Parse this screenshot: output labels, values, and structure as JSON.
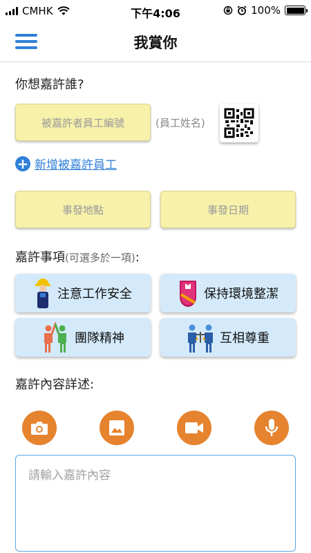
{
  "status_bar": {
    "carrier": "CMHK",
    "time": "下午4:06",
    "battery": "100%",
    "battery_level": 1.0
  },
  "header": {
    "title": "我賞你"
  },
  "recipient": {
    "label": "你想嘉許誰?",
    "employee_id_placeholder": "被嘉許者員工編號",
    "employee_name": "(員工姓名)",
    "add_link": "新增被嘉許員工"
  },
  "event": {
    "location_placeholder": "事發地點",
    "date_placeholder": "事發日期"
  },
  "praise": {
    "label": "嘉許事項",
    "hint": "(可選多於一項)",
    "colon": ":",
    "items": [
      {
        "label": "注意工作安全",
        "icon": "safety-worker-icon"
      },
      {
        "label": "保持環境整潔",
        "icon": "clean-shield-icon"
      },
      {
        "label": "團隊精神",
        "icon": "teamwork-icon"
      },
      {
        "label": "互相尊重",
        "icon": "respect-icon"
      }
    ]
  },
  "details": {
    "label": "嘉許內容詳述:",
    "placeholder": "請輸入嘉許內容",
    "media_buttons": [
      "camera-icon",
      "image-icon",
      "video-icon",
      "microphone-icon"
    ]
  },
  "colors": {
    "accent_blue": "#2e7fd8",
    "field_yellow": "#f7f1aa",
    "chip_blue": "#d4eafb",
    "media_orange": "#e6832e"
  }
}
